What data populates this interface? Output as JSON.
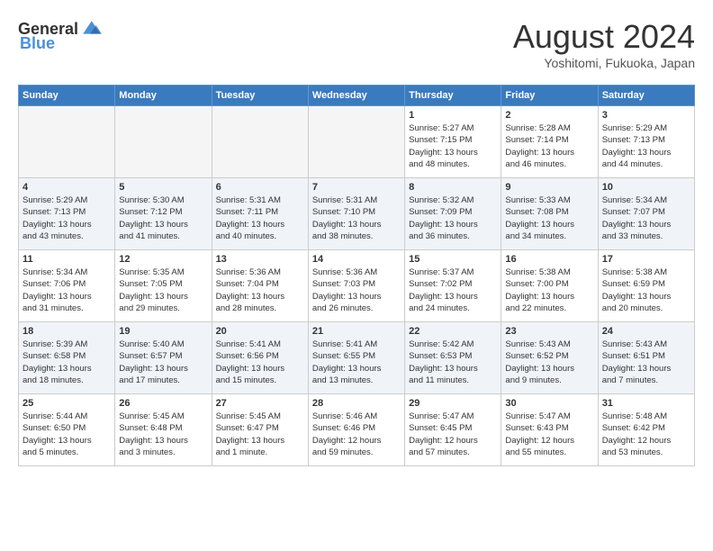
{
  "header": {
    "logo_general": "General",
    "logo_blue": "Blue",
    "month_title": "August 2024",
    "subtitle": "Yoshitomi, Fukuoka, Japan"
  },
  "weekdays": [
    "Sunday",
    "Monday",
    "Tuesday",
    "Wednesday",
    "Thursday",
    "Friday",
    "Saturday"
  ],
  "rows": [
    [
      {
        "day": "",
        "info": "",
        "empty": true
      },
      {
        "day": "",
        "info": "",
        "empty": true
      },
      {
        "day": "",
        "info": "",
        "empty": true
      },
      {
        "day": "",
        "info": "",
        "empty": true
      },
      {
        "day": "1",
        "info": "Sunrise: 5:27 AM\nSunset: 7:15 PM\nDaylight: 13 hours\nand 48 minutes."
      },
      {
        "day": "2",
        "info": "Sunrise: 5:28 AM\nSunset: 7:14 PM\nDaylight: 13 hours\nand 46 minutes."
      },
      {
        "day": "3",
        "info": "Sunrise: 5:29 AM\nSunset: 7:13 PM\nDaylight: 13 hours\nand 44 minutes."
      }
    ],
    [
      {
        "day": "4",
        "info": "Sunrise: 5:29 AM\nSunset: 7:13 PM\nDaylight: 13 hours\nand 43 minutes."
      },
      {
        "day": "5",
        "info": "Sunrise: 5:30 AM\nSunset: 7:12 PM\nDaylight: 13 hours\nand 41 minutes."
      },
      {
        "day": "6",
        "info": "Sunrise: 5:31 AM\nSunset: 7:11 PM\nDaylight: 13 hours\nand 40 minutes."
      },
      {
        "day": "7",
        "info": "Sunrise: 5:31 AM\nSunset: 7:10 PM\nDaylight: 13 hours\nand 38 minutes."
      },
      {
        "day": "8",
        "info": "Sunrise: 5:32 AM\nSunset: 7:09 PM\nDaylight: 13 hours\nand 36 minutes."
      },
      {
        "day": "9",
        "info": "Sunrise: 5:33 AM\nSunset: 7:08 PM\nDaylight: 13 hours\nand 34 minutes."
      },
      {
        "day": "10",
        "info": "Sunrise: 5:34 AM\nSunset: 7:07 PM\nDaylight: 13 hours\nand 33 minutes."
      }
    ],
    [
      {
        "day": "11",
        "info": "Sunrise: 5:34 AM\nSunset: 7:06 PM\nDaylight: 13 hours\nand 31 minutes."
      },
      {
        "day": "12",
        "info": "Sunrise: 5:35 AM\nSunset: 7:05 PM\nDaylight: 13 hours\nand 29 minutes."
      },
      {
        "day": "13",
        "info": "Sunrise: 5:36 AM\nSunset: 7:04 PM\nDaylight: 13 hours\nand 28 minutes."
      },
      {
        "day": "14",
        "info": "Sunrise: 5:36 AM\nSunset: 7:03 PM\nDaylight: 13 hours\nand 26 minutes."
      },
      {
        "day": "15",
        "info": "Sunrise: 5:37 AM\nSunset: 7:02 PM\nDaylight: 13 hours\nand 24 minutes."
      },
      {
        "day": "16",
        "info": "Sunrise: 5:38 AM\nSunset: 7:00 PM\nDaylight: 13 hours\nand 22 minutes."
      },
      {
        "day": "17",
        "info": "Sunrise: 5:38 AM\nSunset: 6:59 PM\nDaylight: 13 hours\nand 20 minutes."
      }
    ],
    [
      {
        "day": "18",
        "info": "Sunrise: 5:39 AM\nSunset: 6:58 PM\nDaylight: 13 hours\nand 18 minutes."
      },
      {
        "day": "19",
        "info": "Sunrise: 5:40 AM\nSunset: 6:57 PM\nDaylight: 13 hours\nand 17 minutes."
      },
      {
        "day": "20",
        "info": "Sunrise: 5:41 AM\nSunset: 6:56 PM\nDaylight: 13 hours\nand 15 minutes."
      },
      {
        "day": "21",
        "info": "Sunrise: 5:41 AM\nSunset: 6:55 PM\nDaylight: 13 hours\nand 13 minutes."
      },
      {
        "day": "22",
        "info": "Sunrise: 5:42 AM\nSunset: 6:53 PM\nDaylight: 13 hours\nand 11 minutes."
      },
      {
        "day": "23",
        "info": "Sunrise: 5:43 AM\nSunset: 6:52 PM\nDaylight: 13 hours\nand 9 minutes."
      },
      {
        "day": "24",
        "info": "Sunrise: 5:43 AM\nSunset: 6:51 PM\nDaylight: 13 hours\nand 7 minutes."
      }
    ],
    [
      {
        "day": "25",
        "info": "Sunrise: 5:44 AM\nSunset: 6:50 PM\nDaylight: 13 hours\nand 5 minutes."
      },
      {
        "day": "26",
        "info": "Sunrise: 5:45 AM\nSunset: 6:48 PM\nDaylight: 13 hours\nand 3 minutes."
      },
      {
        "day": "27",
        "info": "Sunrise: 5:45 AM\nSunset: 6:47 PM\nDaylight: 13 hours\nand 1 minute."
      },
      {
        "day": "28",
        "info": "Sunrise: 5:46 AM\nSunset: 6:46 PM\nDaylight: 12 hours\nand 59 minutes."
      },
      {
        "day": "29",
        "info": "Sunrise: 5:47 AM\nSunset: 6:45 PM\nDaylight: 12 hours\nand 57 minutes."
      },
      {
        "day": "30",
        "info": "Sunrise: 5:47 AM\nSunset: 6:43 PM\nDaylight: 12 hours\nand 55 minutes."
      },
      {
        "day": "31",
        "info": "Sunrise: 5:48 AM\nSunset: 6:42 PM\nDaylight: 12 hours\nand 53 minutes."
      }
    ]
  ]
}
